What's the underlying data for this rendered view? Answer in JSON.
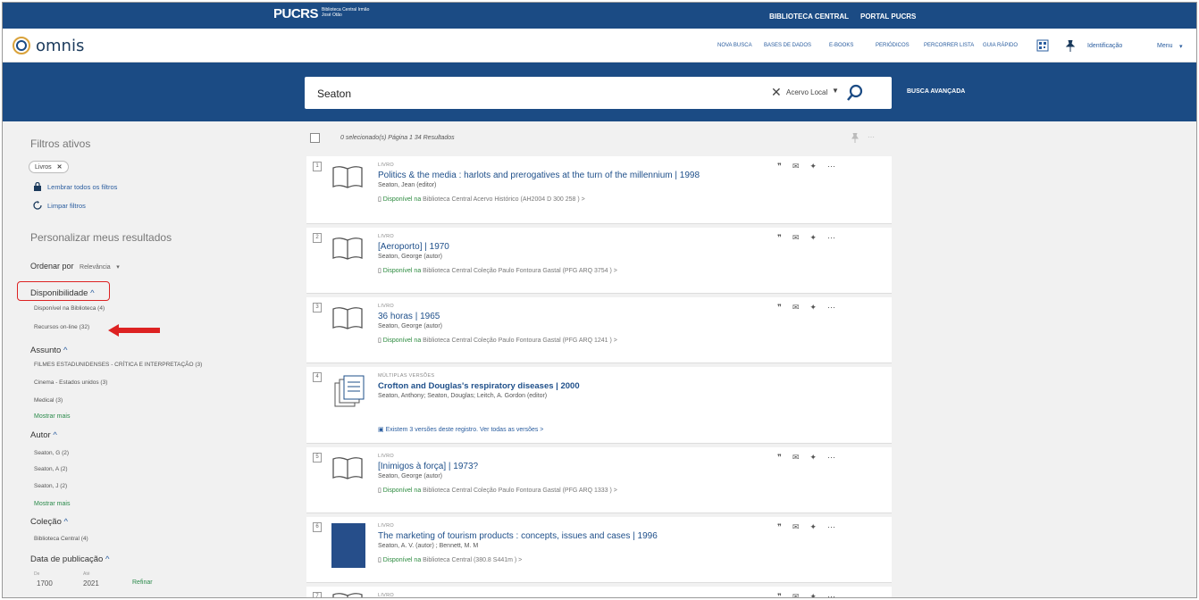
{
  "pucrs": {
    "logo": "PUCRS",
    "sublogo": "Biblioteca Central Irmão José Otão",
    "links": [
      "BIBLIOTECA CENTRAL",
      "PORTAL PUCRS"
    ]
  },
  "omnis": {
    "brand": "omnis",
    "nav": [
      "NOVA BUSCA",
      "BASES DE DADOS",
      "E-BOOKS",
      "PERIÓDICOS",
      "PERCORRER LISTA",
      "GUIA RÁPIDO"
    ],
    "identificacao": "Identificação",
    "menu": "Menu"
  },
  "search": {
    "query": "Seaton",
    "scope": "Acervo Local",
    "advanced": "BUSCA AVANÇADA"
  },
  "sidebar": {
    "active_title": "Filtros ativos",
    "chip": "Livros",
    "remember": "Lembrar todos os filtros",
    "clear": "Limpar filtros",
    "personalize": "Personalizar meus resultados",
    "sort_label": "Ordenar por",
    "sort_value": "Relevância",
    "facets": {
      "disponibilidade": {
        "title": "Disponibilidade",
        "items": [
          "Disponível na Biblioteca (4)",
          "Recursos on-line (32)"
        ]
      },
      "assunto": {
        "title": "Assunto",
        "items": [
          "FILMES ESTADUNIDENSES - CRÍTICA E INTERPRETAÇÃO (3)",
          "Cinema - Estados unidos (3)",
          "Medical (3)"
        ],
        "more": "Mostrar mais"
      },
      "autor": {
        "title": "Autor",
        "items": [
          "Seaton, G (2)",
          "Seaton, A (2)",
          "Seaton, J (2)"
        ],
        "more": "Mostrar mais"
      },
      "colecao": {
        "title": "Coleção",
        "items": [
          "Biblioteca Central (4)"
        ]
      },
      "data": {
        "title": "Data de publicação",
        "from_label": "De",
        "to_label": "Até",
        "from": "1700",
        "to": "2021",
        "refine": "Refinar"
      }
    }
  },
  "results": {
    "header": "0 selecionado(s)   Página 1    34 Resultados",
    "items": [
      {
        "n": "1",
        "type": "LIVRO",
        "title": "Politics & the media : harlots and prerogatives at the turn of the millennium | 1998",
        "author": "Seaton, Jean (editor)",
        "avail": "Disponível na",
        "loc": "Biblioteca Central  Acervo Histórico (AH2004 D 300 258 ) >"
      },
      {
        "n": "2",
        "type": "LIVRO",
        "title": "[Aeroporto] | 1970",
        "author": "Seaton, George (autor)",
        "avail": "Disponível na",
        "loc": "Biblioteca Central  Coleção Paulo Fontoura Gastal (PFG ARQ 3754 ) >"
      },
      {
        "n": "3",
        "type": "LIVRO",
        "title": "36 horas | 1965",
        "author": "Seaton, George (autor)",
        "avail": "Disponível na",
        "loc": "Biblioteca Central  Coleção Paulo Fontoura Gastal (PFG ARQ 1241 ) >"
      },
      {
        "n": "4",
        "type": "MÚLTIPLAS VERSÕES",
        "title": "Crofton and Douglas's respiratory diseases | 2000",
        "author": "Seaton, Anthony; Seaton, Douglas; Leitch, A. Gordon (editor)",
        "avail": "",
        "loc": "Existem 3 versões deste registro. Ver todas as versões >"
      },
      {
        "n": "5",
        "type": "LIVRO",
        "title": "[Inimigos à força] | 1973?",
        "author": "Seaton, George (autor)",
        "avail": "Disponível na",
        "loc": "Biblioteca Central  Coleção Paulo Fontoura Gastal (PFG ARQ 1333 ) >"
      },
      {
        "n": "6",
        "type": "LIVRO",
        "title": "The marketing of tourism products : concepts, issues and cases | 1996",
        "author": "Seaton, A. V. (autor) ; Bennett, M. M",
        "avail": "Disponível na",
        "loc": "Biblioteca Central  (380.8 S441m ) >"
      },
      {
        "n": "7",
        "type": "LIVRO",
        "title": "",
        "author": "",
        "avail": "",
        "loc": ""
      }
    ]
  }
}
